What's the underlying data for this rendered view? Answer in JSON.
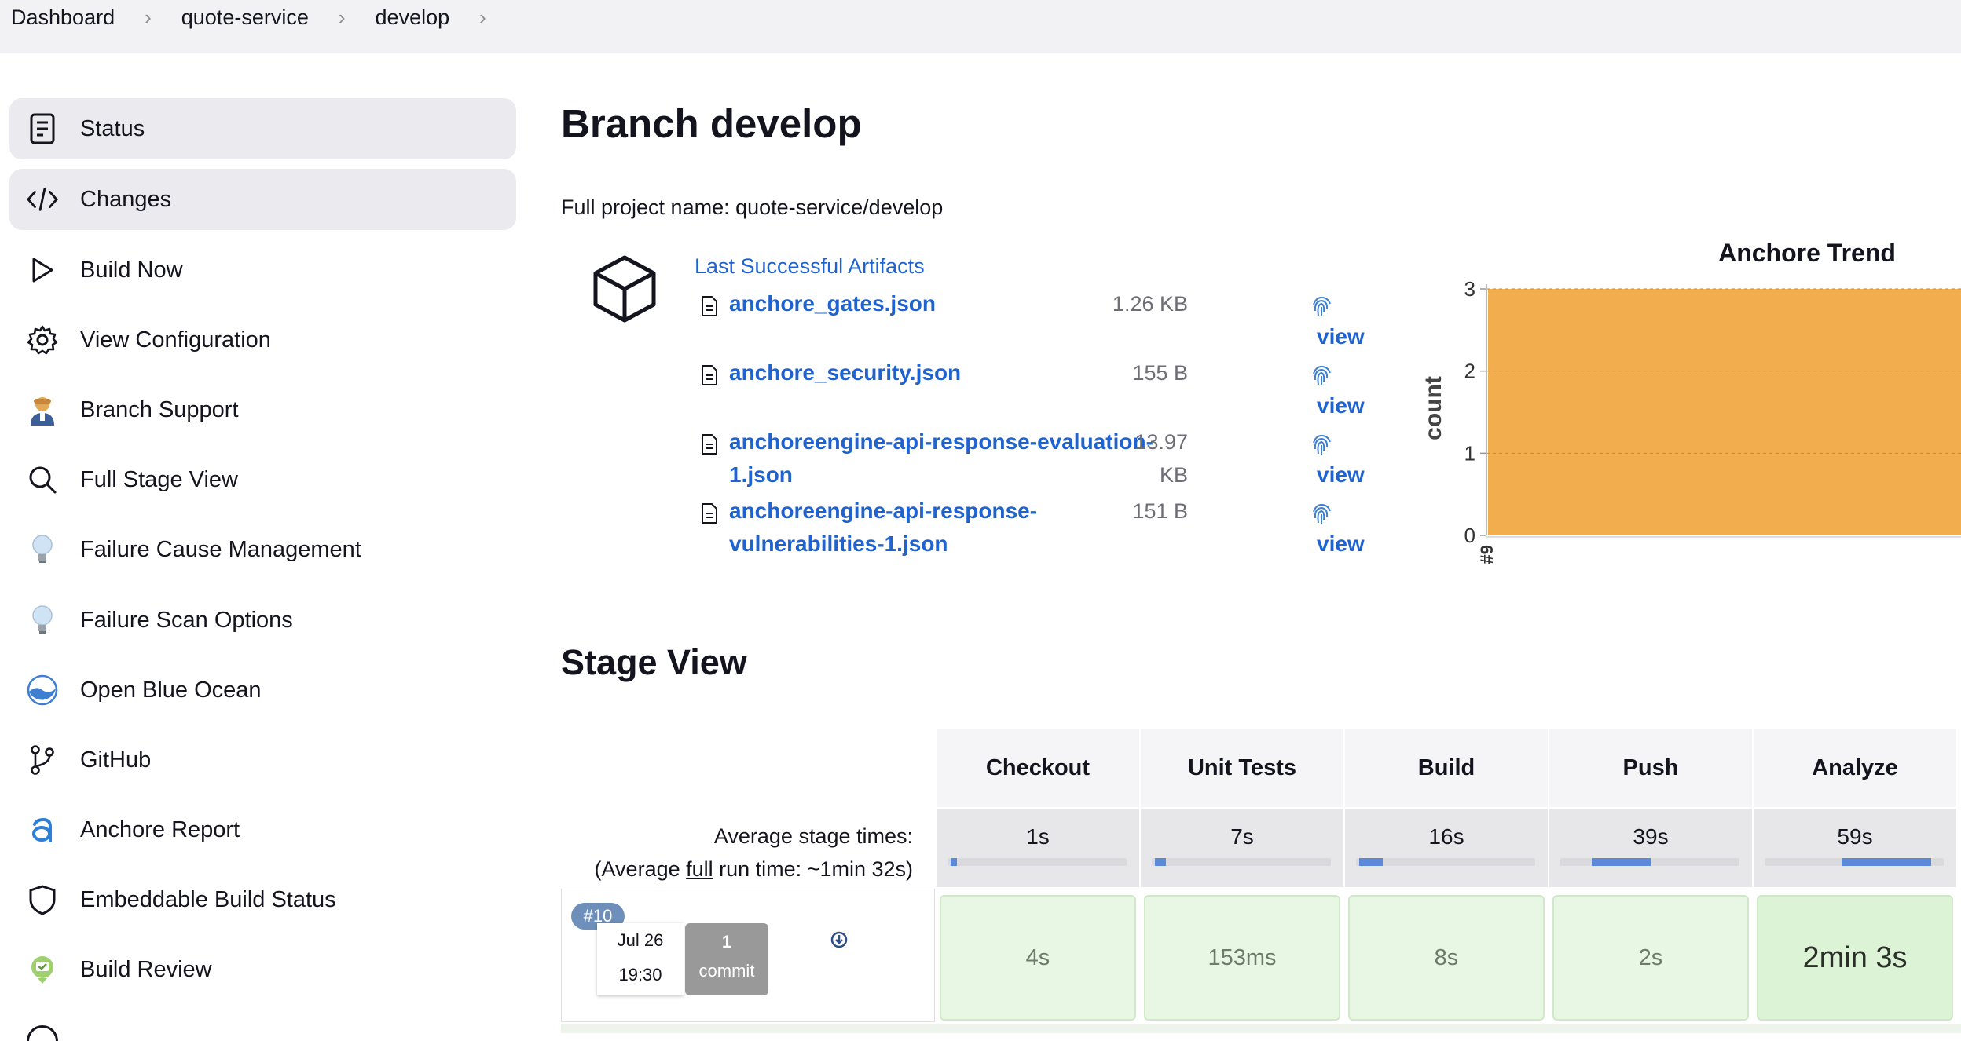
{
  "breadcrumb": [
    "Dashboard",
    "quote-service",
    "develop"
  ],
  "sidebar": {
    "items": [
      {
        "label": "Status",
        "icon": "document-icon"
      },
      {
        "label": "Changes",
        "icon": "code-icon"
      },
      {
        "label": "Build Now",
        "icon": "play-icon"
      },
      {
        "label": "View Configuration",
        "icon": "gear-icon"
      },
      {
        "label": "Branch Support",
        "icon": "support-person-icon"
      },
      {
        "label": "Full Stage View",
        "icon": "magnifier-icon"
      },
      {
        "label": "Failure Cause Management",
        "icon": "lightbulb-icon"
      },
      {
        "label": "Failure Scan Options",
        "icon": "lightbulb-icon"
      },
      {
        "label": "Open Blue Ocean",
        "icon": "blue-ocean-icon"
      },
      {
        "label": "GitHub",
        "icon": "branch-icon"
      },
      {
        "label": "Anchore Report",
        "icon": "anchore-icon"
      },
      {
        "label": "Embeddable Build Status",
        "icon": "shield-icon"
      },
      {
        "label": "Build Review",
        "icon": "review-icon"
      }
    ]
  },
  "main": {
    "title": "Branch develop",
    "full_project_name": "Full project name: quote-service/develop",
    "artifacts": {
      "title": "Last Successful Artifacts",
      "view_label": "view",
      "files": [
        {
          "name": "anchore_gates.json",
          "size": "1.26 KB"
        },
        {
          "name": "anchore_security.json",
          "size": "155 B"
        },
        {
          "name": "anchoreengine-api-response-evaluation-1.json",
          "size": "13.97 KB"
        },
        {
          "name": "anchoreengine-api-response-vulnerabilities-1.json",
          "size": "151 B"
        }
      ]
    }
  },
  "chart_data": {
    "type": "area",
    "title": "Anchore Trend",
    "ylabel": "count",
    "xlabel": "",
    "categories": [
      "#9"
    ],
    "series": [
      {
        "values": [
          3
        ],
        "color": "#f2ad4e"
      }
    ],
    "ylim": [
      0,
      3
    ],
    "yticks": [
      0,
      1,
      2,
      3
    ],
    "grid": true
  },
  "stage_view": {
    "title": "Stage View",
    "avg_label": "Average stage times:",
    "avg_full_prefix": "(Average ",
    "avg_full_word": "full",
    "avg_full_suffix": " run time: ~1min 32s)",
    "stages": [
      {
        "name": "Checkout",
        "avg": "1s",
        "avg_fraction": 0.02,
        "run": "4s"
      },
      {
        "name": "Unit Tests",
        "avg": "7s",
        "avg_fraction": 0.06,
        "run": "153ms"
      },
      {
        "name": "Build",
        "avg": "16s",
        "avg_fraction": 0.13,
        "run": "8s"
      },
      {
        "name": "Push",
        "avg": "39s",
        "avg_fraction": 0.33,
        "run": "2s"
      },
      {
        "name": "Analyze",
        "avg": "59s",
        "avg_fraction": 0.5,
        "run": "2min 3s"
      }
    ],
    "run": {
      "number": "#10",
      "date": "Jul 26",
      "time": "19:30",
      "commits": "1",
      "commit_label": "commit"
    }
  }
}
